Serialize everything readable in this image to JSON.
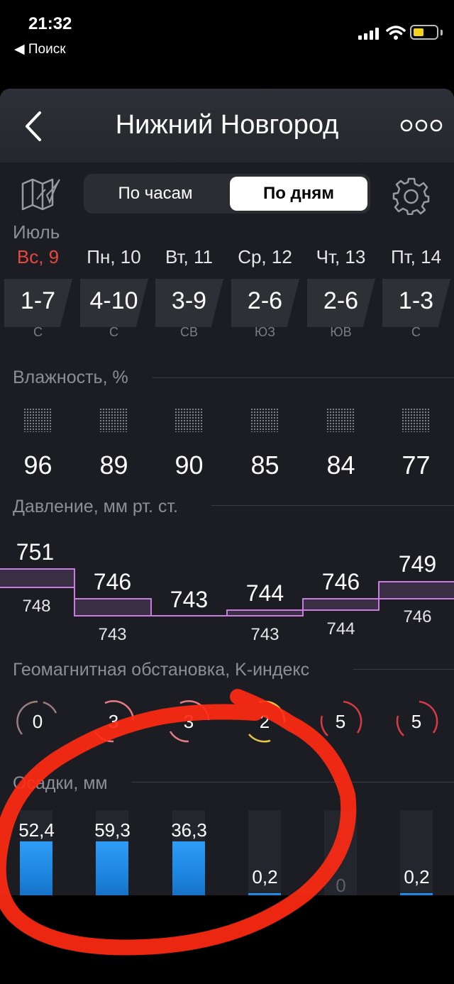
{
  "status_bar": {
    "time": "21:32",
    "back_label": "◀ Поиск"
  },
  "header": {
    "city": "Нижний Новгород"
  },
  "tabs": [
    {
      "label": "По часам",
      "selected": false
    },
    {
      "label": "По дням",
      "selected": true
    }
  ],
  "month": "Июль",
  "days": [
    {
      "label": "Вс, 9",
      "temp": "1-7",
      "wind": "С",
      "humidity": "96",
      "pressure_high": "751",
      "pressure_low": "748",
      "geo_index": "0",
      "precip": "52,4"
    },
    {
      "label": "Пн, 10",
      "temp": "4-10",
      "wind": "С",
      "humidity": "89",
      "pressure_high": "746",
      "pressure_low": "743",
      "geo_index": "3",
      "precip": "59,3"
    },
    {
      "label": "Вт, 11",
      "temp": "3-9",
      "wind": "СВ",
      "humidity": "90",
      "pressure_high": "743",
      "pressure_low": "",
      "geo_index": "3",
      "precip": "36,3"
    },
    {
      "label": "Ср, 12",
      "temp": "2-6",
      "wind": "ЮЗ",
      "humidity": "85",
      "pressure_high": "744",
      "pressure_low": "743",
      "geo_index": "2",
      "precip": "0,2"
    },
    {
      "label": "Чт, 13",
      "temp": "2-6",
      "wind": "ЮВ",
      "humidity": "84",
      "pressure_high": "746",
      "pressure_low": "744",
      "geo_index": "5",
      "precip": "0"
    },
    {
      "label": "Пт, 14",
      "temp": "1-3",
      "wind": "С",
      "humidity": "77",
      "pressure_high": "749",
      "pressure_low": "746",
      "geo_index": "5",
      "precip": "0,2"
    }
  ],
  "sections": {
    "humidity": "Влажность, %",
    "pressure": "Давление, мм рт. ст.",
    "geomagnetic": "Геомагнитная обстановка, K-индекс",
    "precipitation": "Осадки, мм"
  },
  "colors": {
    "sunday": "#e8483f",
    "pressure_line": "#c77de0",
    "geo_0": "#9a7f82",
    "geo_3": "#e77b86",
    "geo_2": "#e7c74a",
    "geo_5": "#d93a46",
    "precip_blue": "#1d86e0",
    "annotation_red": "#ff2a14"
  },
  "icons": [
    "map-icon",
    "gear-icon",
    "back-arrow-icon",
    "more-icon",
    "humidity-dots-icon",
    "wifi-icon",
    "signal-icon",
    "battery-icon"
  ]
}
